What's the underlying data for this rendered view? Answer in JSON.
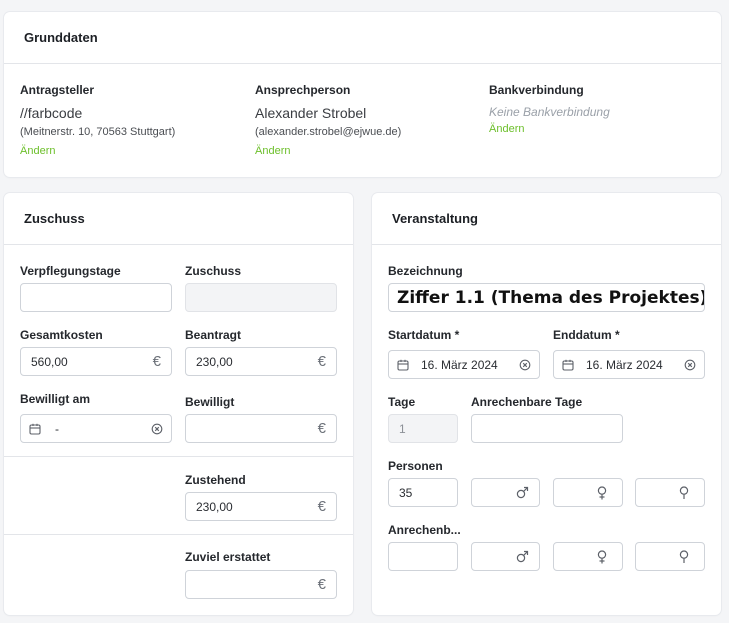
{
  "grunddaten": {
    "title": "Grunddaten",
    "antragsteller": {
      "label": "Antragsteller",
      "name": "//farbcode",
      "detail": "(Meitnerstr. 10, 70563 Stuttgart)",
      "change": "Ändern"
    },
    "ansprechperson": {
      "label": "Ansprechperson",
      "name": "Alexander Strobel",
      "detail": "(alexander.strobel@ejwue.de)",
      "change": "Ändern"
    },
    "bank": {
      "label": "Bankverbindung",
      "empty": "Keine Bankverbindung",
      "change": "Ändern"
    }
  },
  "zuschuss": {
    "title": "Zuschuss",
    "verpflegungstage": {
      "label": "Verpflegungstage",
      "value": ""
    },
    "zuschuss": {
      "label": "Zuschuss",
      "value": ""
    },
    "gesamtkosten": {
      "label": "Gesamtkosten",
      "value": "560,00",
      "suffix": "€"
    },
    "beantragt": {
      "label": "Beantragt",
      "value": "230,00",
      "suffix": "€"
    },
    "bewilligt_am": {
      "label": "Bewilligt am",
      "value": "-"
    },
    "bewilligt": {
      "label": "Bewilligt",
      "value": "",
      "suffix": "€"
    },
    "zustehend": {
      "label": "Zustehend",
      "value": "230,00",
      "suffix": "€"
    },
    "zuviel": {
      "label": "Zuviel erstattet",
      "value": "",
      "suffix": "€"
    }
  },
  "veranstaltung": {
    "title": "Veranstaltung",
    "bezeichnung": {
      "label": "Bezeichnung",
      "value": "Ziffer 1.1 (Thema des Projektes)"
    },
    "startdatum": {
      "label": "Startdatum *",
      "value": "16. März 2024"
    },
    "enddatum": {
      "label": "Enddatum *",
      "value": "16. März 2024"
    },
    "tage": {
      "label": "Tage",
      "value": "1"
    },
    "anrechenbare_tage": {
      "label": "Anrechenbare Tage",
      "value": ""
    },
    "personen": {
      "label": "Personen",
      "value": "35"
    },
    "anrechenbar": {
      "label": "Anrechenb..."
    }
  }
}
